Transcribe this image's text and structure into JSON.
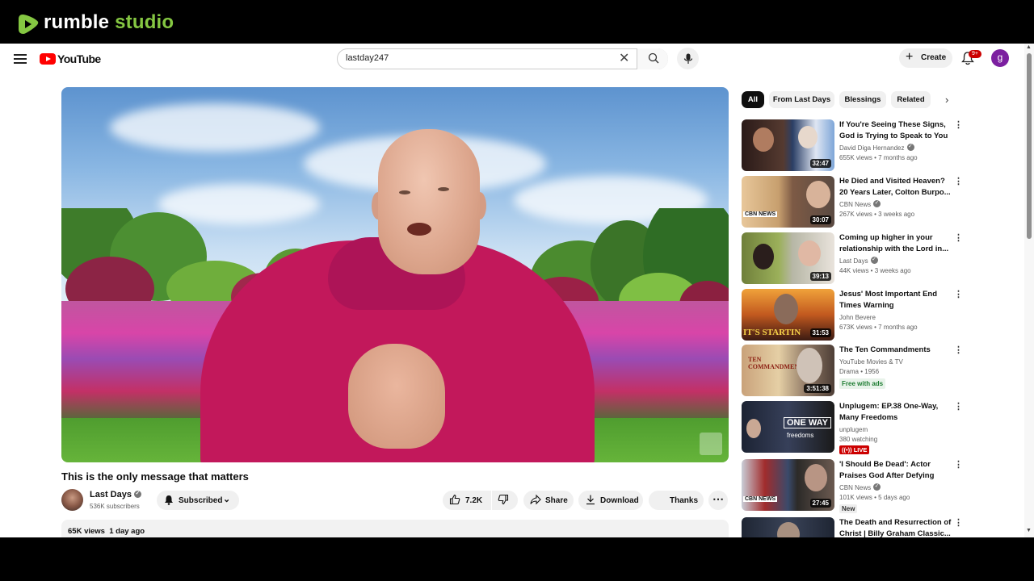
{
  "rumble": {
    "brand": "rumble",
    "product": "studio"
  },
  "header": {
    "logo_text": "YouTube",
    "search_value": "lastday247",
    "create_label": "Create",
    "notif_count": "9+",
    "avatar_letter": "g"
  },
  "video": {
    "title": "This is the only message that matters",
    "channel": "Last Days",
    "subscribers": "536K subscribers",
    "subscribe_label": "Subscribed",
    "likes": "7.2K",
    "share_label": "Share",
    "download_label": "Download",
    "thanks_label": "Thanks",
    "views": "65K views",
    "age": "1 day ago"
  },
  "chips": [
    "All",
    "From Last Days",
    "Blessings",
    "Related"
  ],
  "recommendations": [
    {
      "title": "If You're Seeing These Signs, God is Trying to Speak to You",
      "channel": "David Diga Hernandez",
      "meta": "655K views • 7 months ago",
      "duration": "32:47"
    },
    {
      "title": "He Died and Visited Heaven? 20 Years Later, Colton Burpo...",
      "channel": "CBN News",
      "meta": "267K views • 3 weeks ago",
      "duration": "30:07"
    },
    {
      "title": "Coming up higher in your relationship with the Lord in...",
      "channel": "Last Days",
      "meta": "44K views • 3 weeks ago",
      "duration": "39:13"
    },
    {
      "title": "Jesus' Most Important End Times Warning",
      "channel": "John Bevere",
      "meta": "673K views • 7 months ago",
      "duration": "31:53"
    },
    {
      "title": "The Ten Commandments",
      "channel": "YouTube Movies & TV",
      "meta": "Drama • 1956",
      "duration": "3:51:38",
      "badge": "Free with ads"
    },
    {
      "title": "Unplugem: EP.38 One-Way, Many Freedoms",
      "channel": "unplugem",
      "meta": "380 watching",
      "badge": "LIVE"
    },
    {
      "title": "'I Should Be Dead': Actor Praises God After Defying Odd...",
      "channel": "CBN News",
      "meta": "101K views • 5 days ago",
      "duration": "27:45",
      "badge": "New"
    },
    {
      "title": "The Death and Resurrection of Christ | Billy Graham Classic..."
    }
  ],
  "thumb_text": {
    "cbn": "CBN NEWS",
    "bevere": "IT'S STARTIN",
    "commandments": "TEN COMMANDMENTS",
    "oneway": "ONE WAY",
    "freedoms": "freedoms"
  }
}
